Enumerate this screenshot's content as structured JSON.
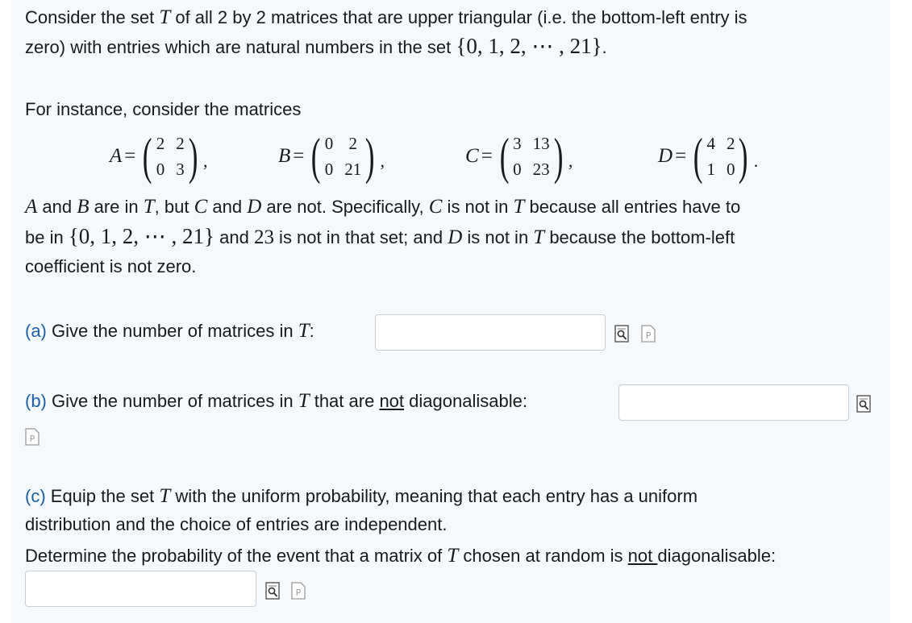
{
  "intro": {
    "line1_a": "Consider the set ",
    "set_symbol": "T",
    "line1_b": " of all 2 by 2 matrices that are upper triangular (i.e. the bottom-left entry is",
    "line2_a": "zero) with entries which are natural numbers in the set ",
    "set_range": "{0, 1, 2, ⋯ , 21}",
    "line2_b": "."
  },
  "examples": {
    "lead": "For instance, consider the matrices",
    "matrices": [
      {
        "name": "A",
        "entries": [
          "2",
          "2",
          "0",
          "3"
        ],
        "punct": ","
      },
      {
        "name": "B",
        "entries": [
          "0",
          "2",
          "0",
          "21"
        ],
        "punct": ","
      },
      {
        "name": "C",
        "entries": [
          "3",
          "13",
          "0",
          "23"
        ],
        "punct": ","
      },
      {
        "name": "D",
        "entries": [
          "4",
          "2",
          "1",
          "0"
        ],
        "punct": "."
      }
    ],
    "note_a1": "A",
    "note_a2": " and ",
    "note_a3": "B",
    "note_a4": " are in ",
    "note_a5": "T",
    "note_a6": ", but ",
    "note_a7": "C",
    "note_a8": " and ",
    "note_a9": "D",
    "note_a10": " are not. Specifically, ",
    "note_a11": "C",
    "note_a12": " is not in ",
    "note_a13": "T",
    "note_a14": " because all entries have to",
    "note_b1": "be in ",
    "note_b2": "{0, 1, 2, ⋯ , 21}",
    "note_b3": " and ",
    "note_b4": "23",
    "note_b5": " is not in that set; and  ",
    "note_b6": "D",
    "note_b7": " is not in ",
    "note_b8": "T",
    "note_b9": " because the bottom-left",
    "note_c": "coefficient is not zero."
  },
  "part_a": {
    "label": "(a)",
    "text": " Give the number of matrices in ",
    "sym": "T",
    "colon": ":",
    "value": "",
    "placeholder": ""
  },
  "part_b": {
    "label": "(b)",
    "text": "  Give the number of matrices in ",
    "sym": "T",
    "text2": " that are ",
    "not": "not",
    "text3": " diagonalisable:",
    "value": "",
    "placeholder": ""
  },
  "part_c": {
    "label": "(c)",
    "line1_a": "  Equip the set ",
    "sym": "T",
    "line1_b": " with the uniform probability, meaning that each entry has a uniform",
    "line2": "distribution and the choice of  entries are independent.",
    "line3_a": "Determine the probability of the event that a matrix of ",
    "sym2": "T",
    "line3_b": " chosen at random is ",
    "not": "not ",
    "line3_c": "diagonalisable:",
    "value": "",
    "placeholder": ""
  },
  "icons": {
    "preview": "preview-icon",
    "help": "help-p-icon"
  },
  "colors": {
    "part_label": "#1b5fa5",
    "panel_bg": "#f5f9fc"
  }
}
